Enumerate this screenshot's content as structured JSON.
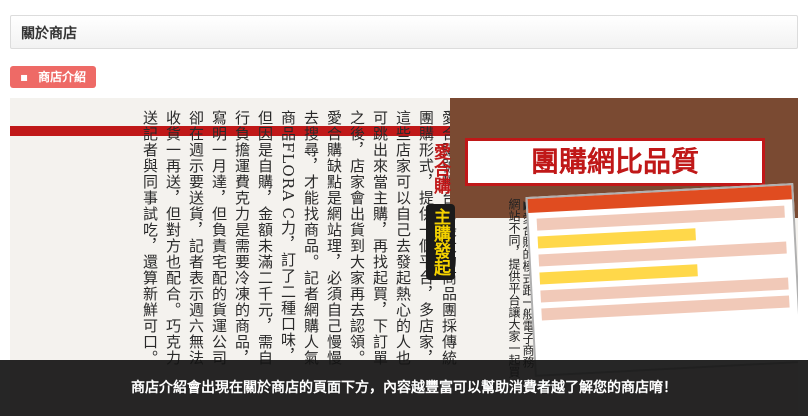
{
  "header": {
    "title": "關於商店"
  },
  "section_tag": {
    "bullet": "▪",
    "label": "商店介紹"
  },
  "magazine": {
    "headline": "團購網比品質",
    "brand_stamp": "愛合購",
    "brand_sub": "主購發起",
    "body_text": "愛合購號稱台灣最大的商品團採傳統團購形式，提供一個平台，多店家，這些店家可以自己去發起熱心的人也可跳出來當主購，再找起買，下訂單之後，店家會出貨到大家再去認領。愛合購缺點是網站理，必須自己慢慢去搜尋，才能找商品。記者網購人氣商品FLORA C力，訂了二種口味，但因是自購，金額未滿二千元，需自行負擔運費克力是需要冷凍的商品，寫明一月達，但負責宅配的貨運公司卻在週示要送貨，記者表示週六無法收貨一再送，但對方也配合。巧克力送記者與同事試吃，還算新鮮可口。",
    "side_note": "▶愛合購的模式跟一般電子商務網站不同，提供平台讓大家一起買",
    "colors": {
      "accent": "#c01818",
      "panel": "#7a4a32",
      "stamp": "#f5d200"
    }
  },
  "caption": {
    "text": "商店介紹會出現在關於商店的頁面下方，內容越豐富可以幫助消費者越了解您的商店唷！"
  }
}
